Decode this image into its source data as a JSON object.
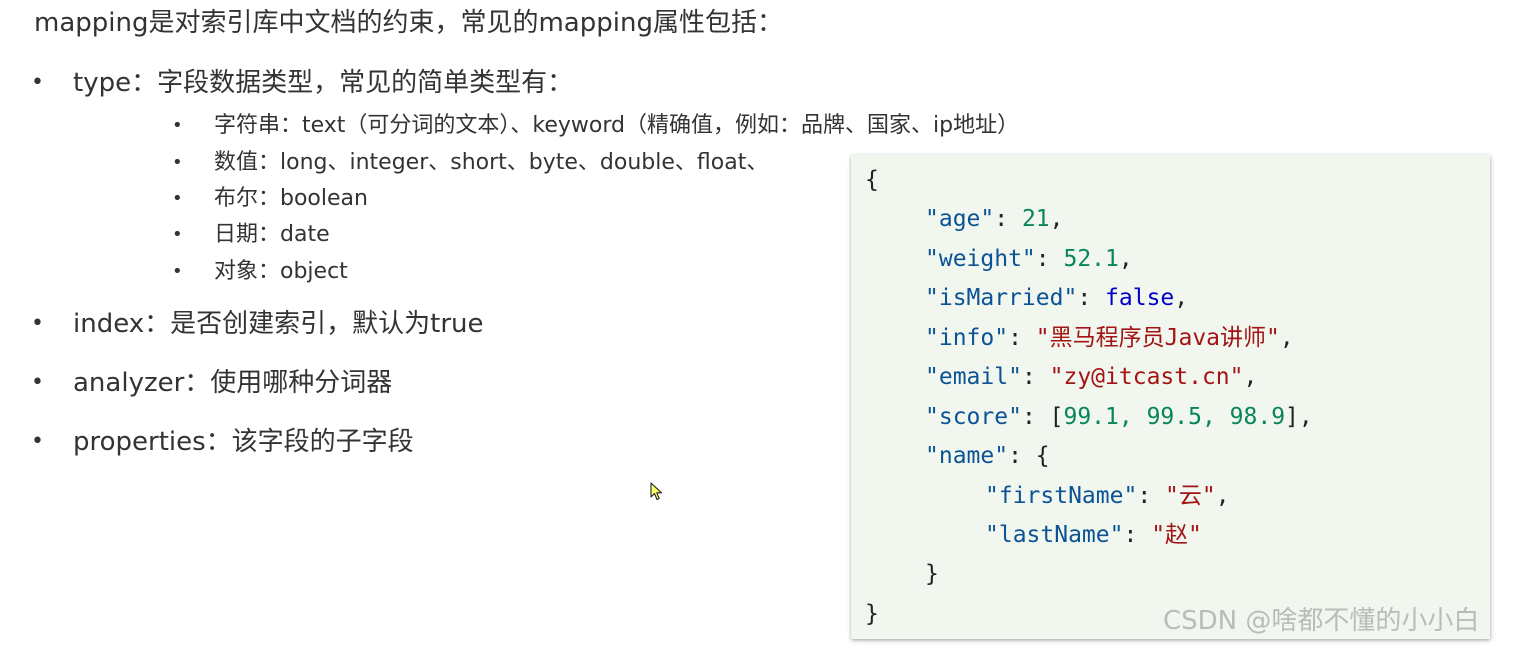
{
  "intro": "mapping是对索引库中文档的约束，常见的mapping属性包括：",
  "bullets": [
    "type：字段数据类型，常见的简单类型有：",
    "index：是否创建索引，默认为true",
    "analyzer：使用哪种分词器",
    "properties：该字段的子字段"
  ],
  "type_subitems": [
    "字符串：text（可分词的文本）、keyword（精确值，例如：品牌、国家、ip地址）",
    "数值：long、integer、short、byte、double、float、",
    "布尔：boolean",
    "日期：date",
    "对象：object"
  ],
  "bullet_symbol": "•",
  "code": {
    "open_brace": "{",
    "close_brace": "}",
    "age_key": "\"age\"",
    "age_value": "21",
    "weight_key": "\"weight\"",
    "weight_value": "52.1",
    "isMarried_key": "\"isMarried\"",
    "isMarried_value": "false",
    "info_key": "\"info\"",
    "info_value": "\"黑马程序员Java讲师\"",
    "email_key": "\"email\"",
    "email_value": "\"zy@itcast.cn\"",
    "score_key": "\"score\"",
    "score_values": "99.1, 99.5, 98.9",
    "name_key": "\"name\"",
    "firstName_key": "\"firstName\"",
    "firstName_value": "\"云\"",
    "lastName_key": "\"lastName\"",
    "lastName_value": "\"赵\""
  },
  "colors": {
    "key": "#0b5394",
    "string": "#a31515",
    "number": "#098658",
    "boolean": "#0000c8",
    "code_background": "#f1f6ef"
  },
  "cursor_icon": "mouse-pointer-icon",
  "watermark": "CSDN @啥都不懂的小小白"
}
